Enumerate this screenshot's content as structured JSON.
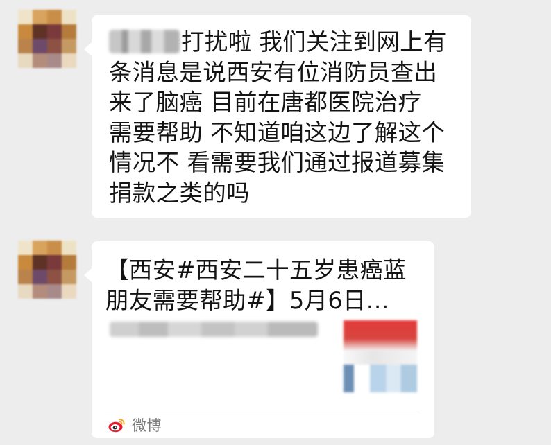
{
  "colors": {
    "background": "#ededed",
    "bubble": "#ffffff",
    "text": "#141414",
    "source_text": "#7a7a7a",
    "weibo_red": "#e6162d",
    "weibo_orange": "#f5a623"
  },
  "messages": [
    {
      "type": "text",
      "avatar": {
        "icon": "avatar-pixelated"
      },
      "sender_masked": true,
      "text": "打扰啦 我们关注到网上有\n条消息是说西安有位消防员查出\n来了脑癌 目前在唐都医院治疗\n需要帮助 不知道咱这边了解这个\n情况不 看需要我们通过报道募集\n捐款之类的吗"
    },
    {
      "type": "link",
      "avatar": {
        "icon": "avatar-pixelated"
      },
      "title": "【西安#西安二十五岁患癌蓝朋友需要帮助#】5月6日...",
      "summary_masked": true,
      "thumbnail_masked": true,
      "source": {
        "icon": "weibo-icon",
        "label": "微博"
      }
    }
  ]
}
